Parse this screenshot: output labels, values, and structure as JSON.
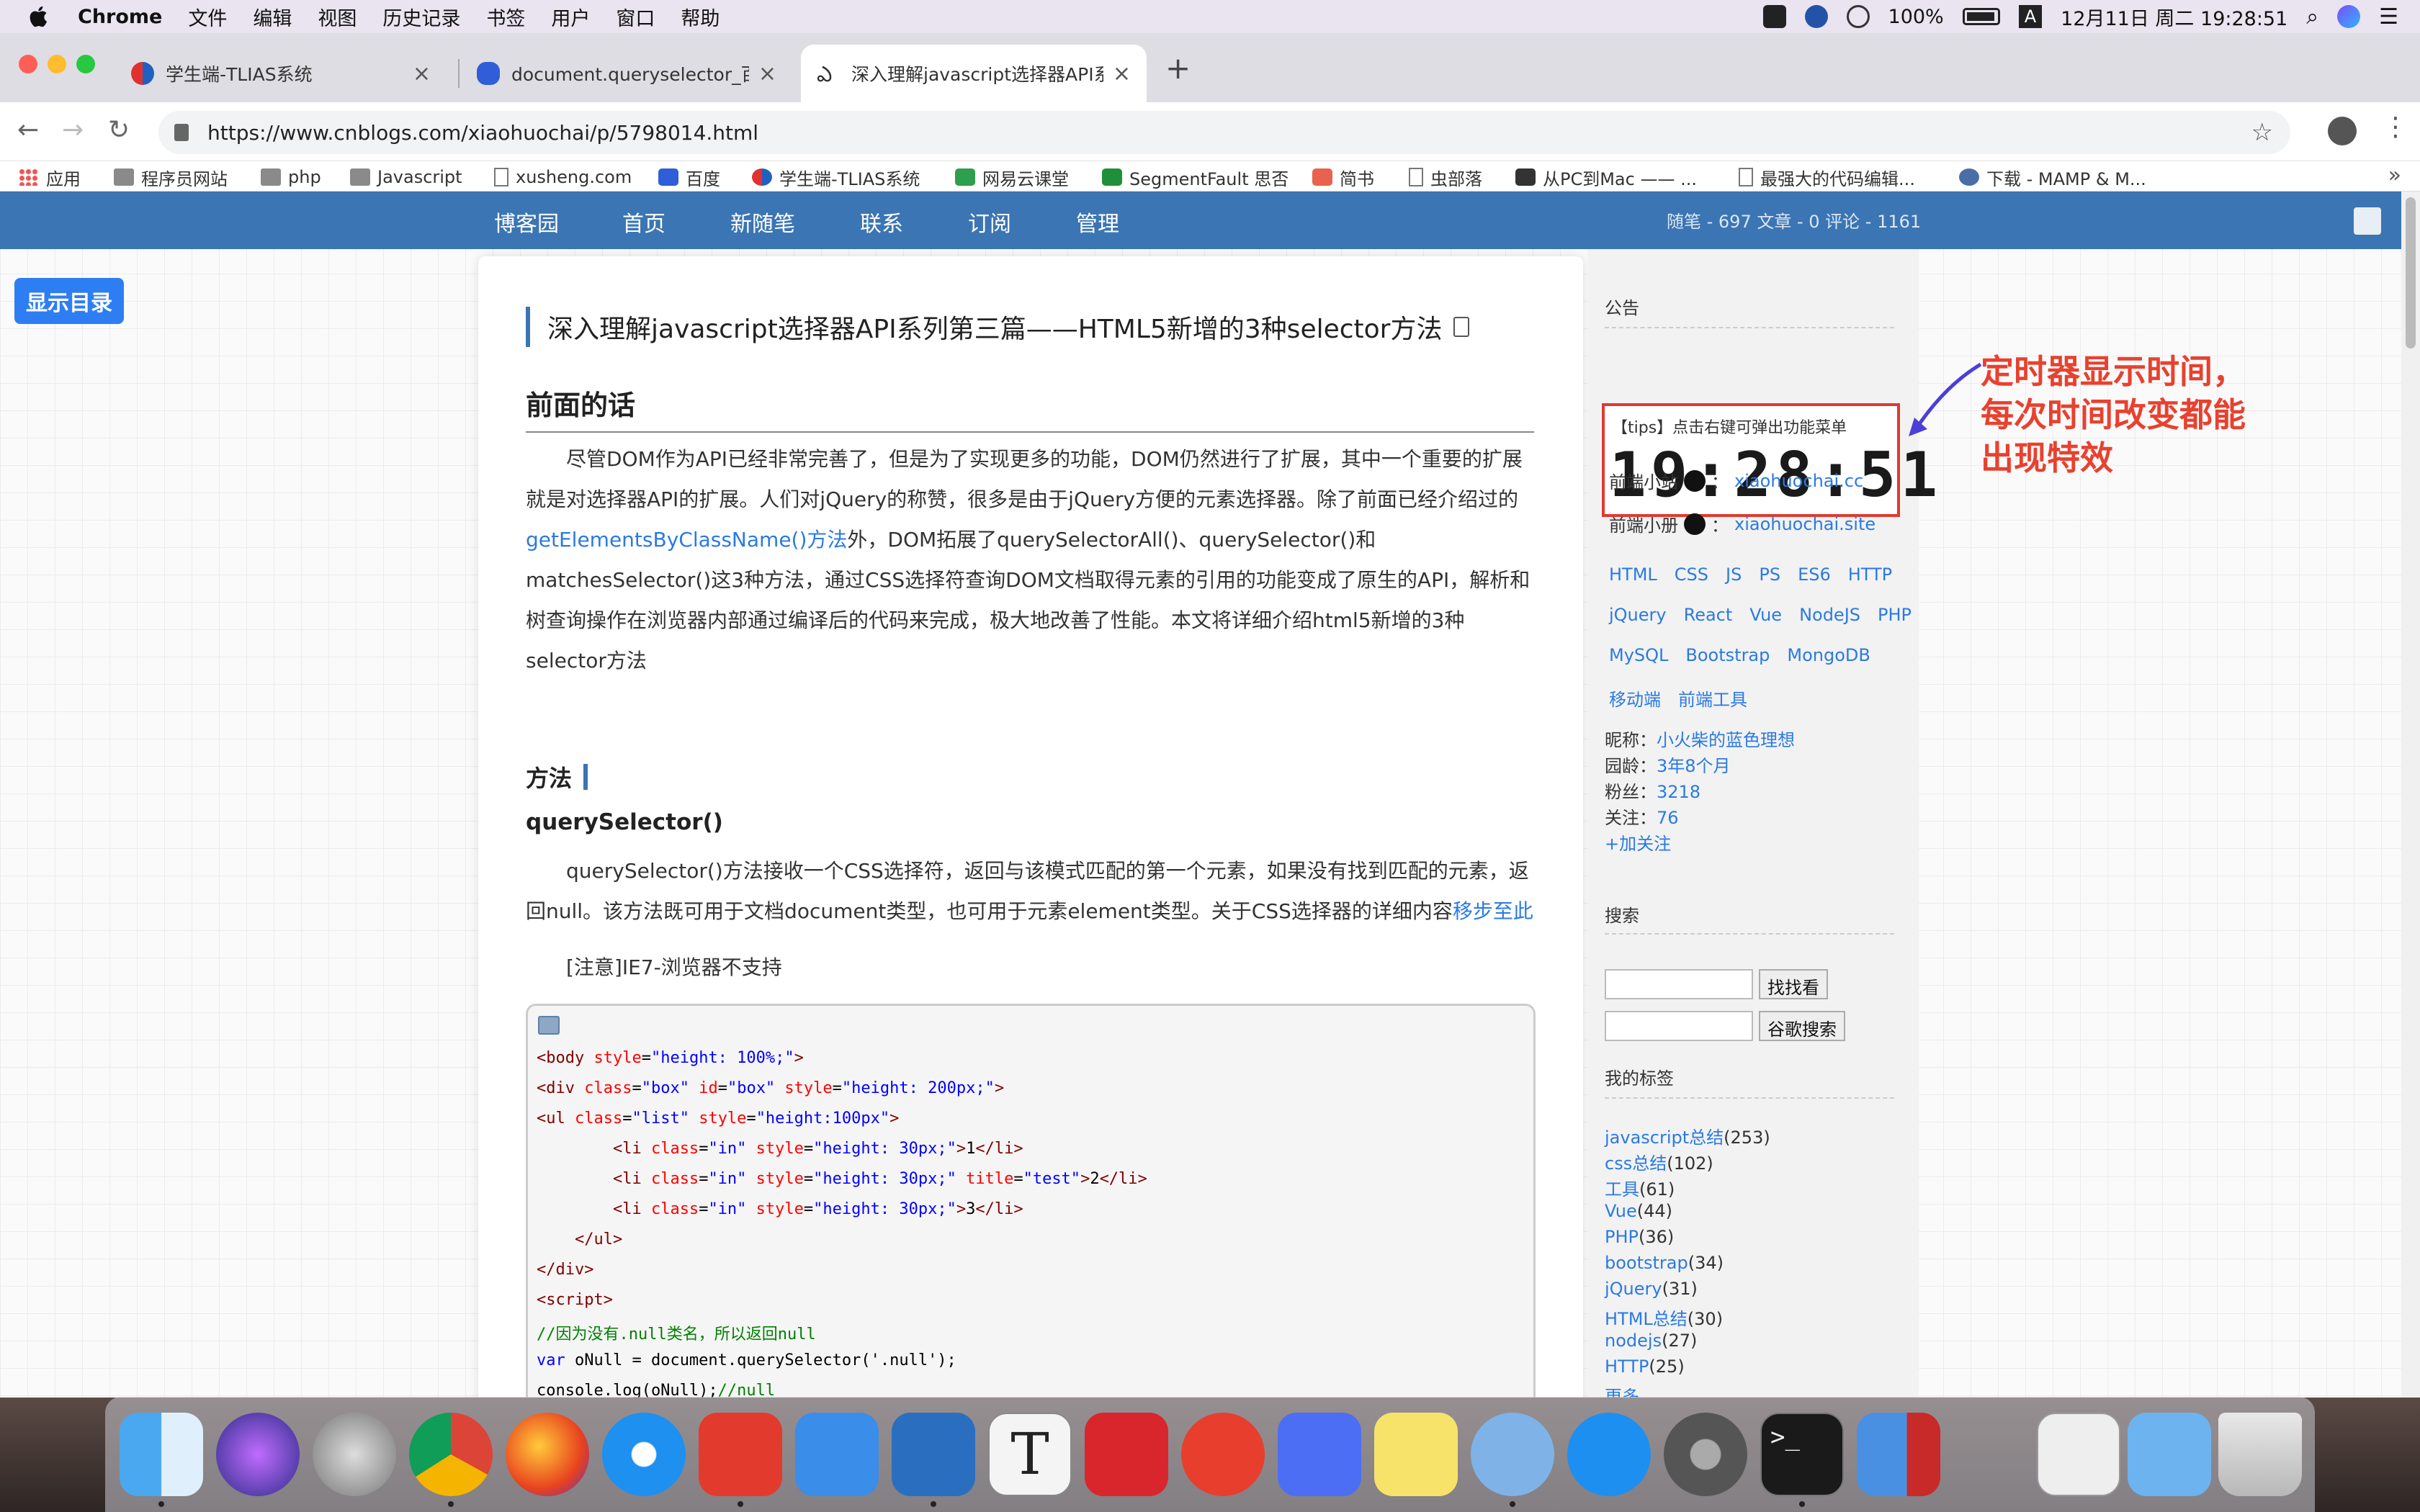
{
  "menubar": {
    "app": "Chrome",
    "items": [
      "文件",
      "编辑",
      "视图",
      "历史记录",
      "书签",
      "用户",
      "窗口",
      "帮助"
    ],
    "battery": "100%",
    "input_method": "A",
    "datetime": "12月11日 周二  19:28:51"
  },
  "tabs": [
    {
      "title": "学生端-TLIAS系统"
    },
    {
      "title": "document.queryselector_百度搜"
    },
    {
      "title": "深入理解javascript选择器API系列"
    }
  ],
  "address": {
    "url": "https://www.cnblogs.com/xiaohuochai/p/5798014.html"
  },
  "bookmarks": [
    "应用",
    "程序员网站",
    "php",
    "Javascript",
    "xusheng.com",
    "百度",
    "学生端-TLIAS系统",
    "网易云课堂",
    "SegmentFault 思否",
    "简书",
    "虫部落",
    "从PC到Mac —— ...",
    "最强大的代码编辑...",
    "下载 - MAMP & M..."
  ],
  "site": {
    "nav": [
      "博客园",
      "首页",
      "新随笔",
      "联系",
      "订阅",
      "管理"
    ],
    "stats": "随笔 - 697  文章 - 0  评论 - 1161"
  },
  "toc_button": "显示目录",
  "post": {
    "title": "深入理解javascript选择器API系列第三篇——HTML5新增的3种selector方法",
    "heading": "前面的话",
    "intro_1": "尽管DOM作为API已经非常完善了，但是为了实现更多的功能，DOM仍然进行了扩展，其中一个重要的扩展就是对选择器API的扩展。人们对jQuery的称赞，很多是由于jQuery方便的元素选择器。除了前面已经介绍过的",
    "intro_link": "getElementsByClassName()方法",
    "intro_2": "外，DOM拓展了querySelectorAll()、querySelector()和matchesSelector()这3种方法，通过CSS选择符查询DOM文档取得元素的引用的功能变成了原生的API，解析和树查询操作在浏览器内部通过编译后的代码来完成，极大地改善了性能。本文将详细介绍html5新增的3种selector方法",
    "section": "方法",
    "subsection": "querySelector()",
    "qs_text": "querySelector()方法接收一个CSS选择符，返回与该模式匹配的第一个元素，如果没有找到匹配的元素，返回null。该方法既可用于文档document类型，也可用于元素element类型。关于CSS选择器的详细内容",
    "qs_link": "移步至此",
    "note": "[注意]IE7-浏览器不支持"
  },
  "sidebar": {
    "notice": "公告",
    "tips": "【tips】点击右键可弹出功能菜单",
    "clock": "19:28:51",
    "site1_label": "前端小站",
    "site1_url": "xiaohuochai.cc",
    "site2_label": "前端小册",
    "site2_url": "xiaohuochai.site",
    "colon": "：",
    "tags_row1": [
      "HTML",
      "CSS",
      "JS",
      "PS",
      "ES6",
      "HTTP"
    ],
    "tags_row2": [
      "jQuery",
      "React",
      "Vue",
      "NodeJS",
      "PHP"
    ],
    "tags_row3": [
      "MySQL",
      "Bootstrap",
      "MongoDB"
    ],
    "tags_row4": [
      "移动端",
      "前端工具"
    ],
    "nickname_label": "昵称：",
    "nickname": "小火柴的蓝色理想",
    "age_label": "园龄：",
    "age": "3年8个月",
    "fans_label": "粉丝：",
    "fans": "3218",
    "follow_label": "关注：",
    "follow": "76",
    "add_follow": "+加关注",
    "search_title": "搜索",
    "search_btn": "找找看",
    "google_btn": "谷歌搜索",
    "my_tags": "我的标签",
    "tag_counts": [
      {
        "name": "javascript总结",
        "count": "(253)"
      },
      {
        "name": "css总结",
        "count": "(102)"
      },
      {
        "name": "工具",
        "count": "(61)"
      },
      {
        "name": "Vue",
        "count": "(44)"
      },
      {
        "name": "PHP",
        "count": "(36)"
      },
      {
        "name": "bootstrap",
        "count": "(34)"
      },
      {
        "name": "jQuery",
        "count": "(31)"
      },
      {
        "name": "HTML总结",
        "count": "(30)"
      },
      {
        "name": "nodejs",
        "count": "(27)"
      },
      {
        "name": "HTTP",
        "count": "(25)"
      },
      {
        "name": "更多",
        "count": ""
      }
    ]
  },
  "annotation": {
    "line1": "定时器显示时间，",
    "line2": "每次时间改变都能",
    "line3": "出现特效"
  },
  "colors": {
    "accent": "#3b75b3",
    "link": "#2a7ae2",
    "annotation": "#e8412f"
  }
}
